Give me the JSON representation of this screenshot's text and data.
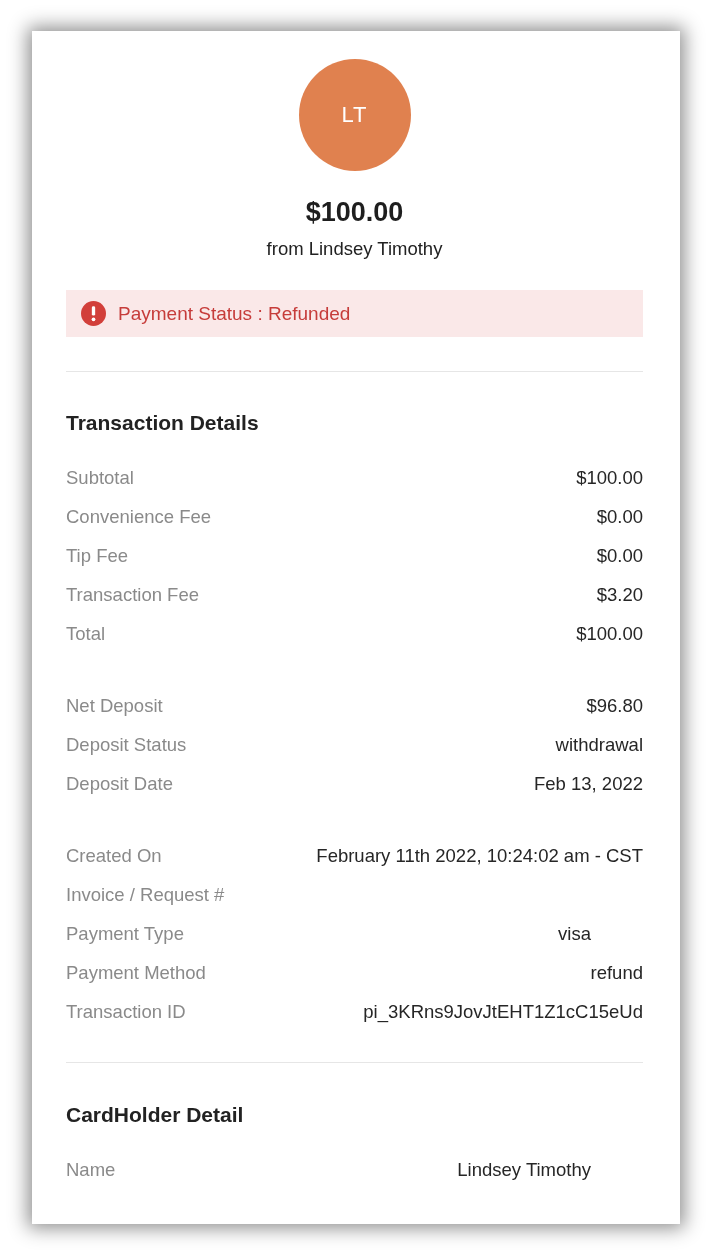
{
  "avatar": {
    "initials": "LT"
  },
  "amount": "$100.00",
  "from_line": "from Lindsey Timothy",
  "status_alert": {
    "kind": "error",
    "text": "Payment Status : Refunded"
  },
  "sections": [
    {
      "title": "Transaction Details",
      "groups": [
        {
          "rows": [
            {
              "kind": "plain",
              "label": "Subtotal",
              "value": "$100.00"
            },
            {
              "kind": "plain",
              "label": "Convenience Fee",
              "value": "$0.00"
            },
            {
              "kind": "plain",
              "label": "Tip Fee",
              "value": "$0.00"
            },
            {
              "kind": "plain",
              "label": "Transaction Fee",
              "value": "$3.20"
            },
            {
              "kind": "plain",
              "label": "Total",
              "value": "$100.00"
            }
          ]
        },
        {
          "rows": [
            {
              "kind": "plain",
              "label": "Net Deposit",
              "value": "$96.80"
            },
            {
              "kind": "plain",
              "label": "Deposit Status",
              "value": "withdrawal"
            },
            {
              "kind": "plain",
              "label": "Deposit Date",
              "value": "Feb 13, 2022"
            }
          ]
        },
        {
          "rows": [
            {
              "kind": "plain",
              "label": "Created On",
              "value": "February 11th 2022, 10:24:02 am - CST"
            },
            {
              "kind": "plain",
              "label": "Invoice / Request #"
            },
            {
              "kind": "inset",
              "label": "Payment Type",
              "value": "visa"
            },
            {
              "kind": "plain",
              "label": "Payment Method",
              "value": "refund"
            },
            {
              "kind": "plain",
              "label": "Transaction ID",
              "value": "pi_3KRns9JovJtEHT1Z1cC15eUd"
            }
          ]
        }
      ]
    },
    {
      "title": "CardHolder Detail",
      "groups": [
        {
          "rows": [
            {
              "kind": "inset",
              "label": "Name",
              "value": "Lindsey Timothy"
            }
          ]
        }
      ]
    }
  ]
}
